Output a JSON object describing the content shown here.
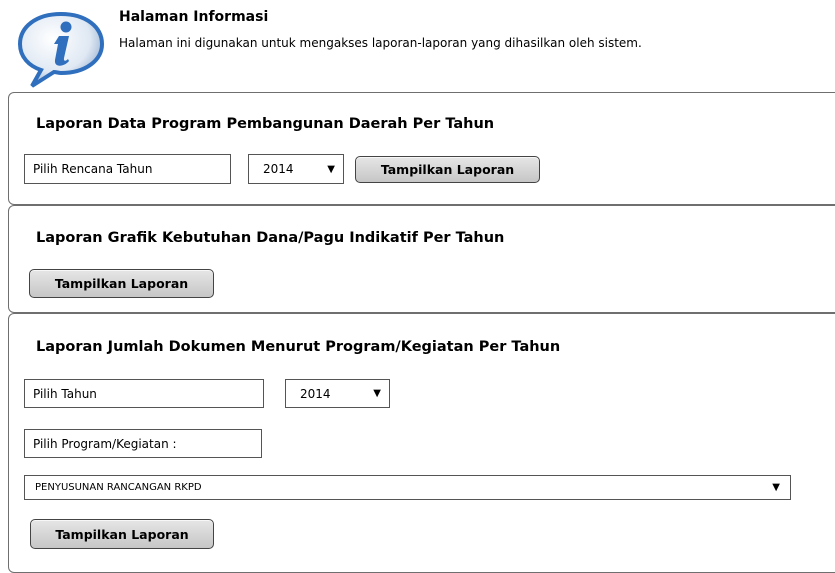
{
  "info": {
    "title": "Halaman Informasi",
    "text": "Halaman ini digunakan untuk mengakses laporan-laporan yang dihasilkan oleh sistem.",
    "icon": "info-icon"
  },
  "panel1": {
    "title": "Laporan Data Program Pembangunan Daerah Per Tahun",
    "label_field": "Pilih Rencana Tahun",
    "year_select": "2014",
    "button": "Tampilkan Laporan"
  },
  "panel2": {
    "title": "Laporan Grafik Kebutuhan Dana/Pagu Indikatif Per Tahun",
    "button": "Tampilkan Laporan"
  },
  "panel3": {
    "title": "Laporan Jumlah Dokumen Menurut Program/Kegiatan Per Tahun",
    "label_year": "Pilih Tahun",
    "year_select": "2014",
    "label_program": "Pilih Program/Kegiatan :",
    "program_select": "PENYUSUNAN RANCANGAN RKPD",
    "button": "Tampilkan Laporan"
  },
  "colors": {
    "border": "#6f6f6f",
    "button_top": "#e6e6e6",
    "button_bottom": "#c6c6c6",
    "icon_blue": "#2f6fbd"
  }
}
